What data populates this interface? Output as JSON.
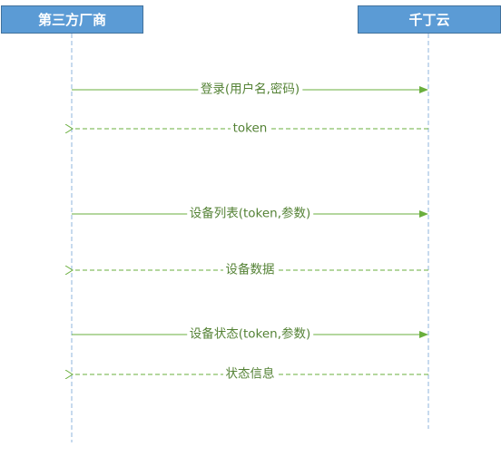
{
  "actors": {
    "left": "第三方厂商",
    "right": "千丁云"
  },
  "messages": [
    {
      "label": "登录(用户名,密码)",
      "direction": "request"
    },
    {
      "label": "token",
      "direction": "response"
    },
    {
      "label": "设备列表(token,参数)",
      "direction": "request"
    },
    {
      "label": "设备数据",
      "direction": "response"
    },
    {
      "label": "设备状态(token,参数)",
      "direction": "request"
    },
    {
      "label": "状态信息",
      "direction": "response"
    }
  ],
  "colors": {
    "actor_fill": "#5b9bd5",
    "actor_border": "#41719c",
    "lifeline": "#8fb6dd",
    "arrow": "#6aaf3d",
    "label": "#548235"
  }
}
